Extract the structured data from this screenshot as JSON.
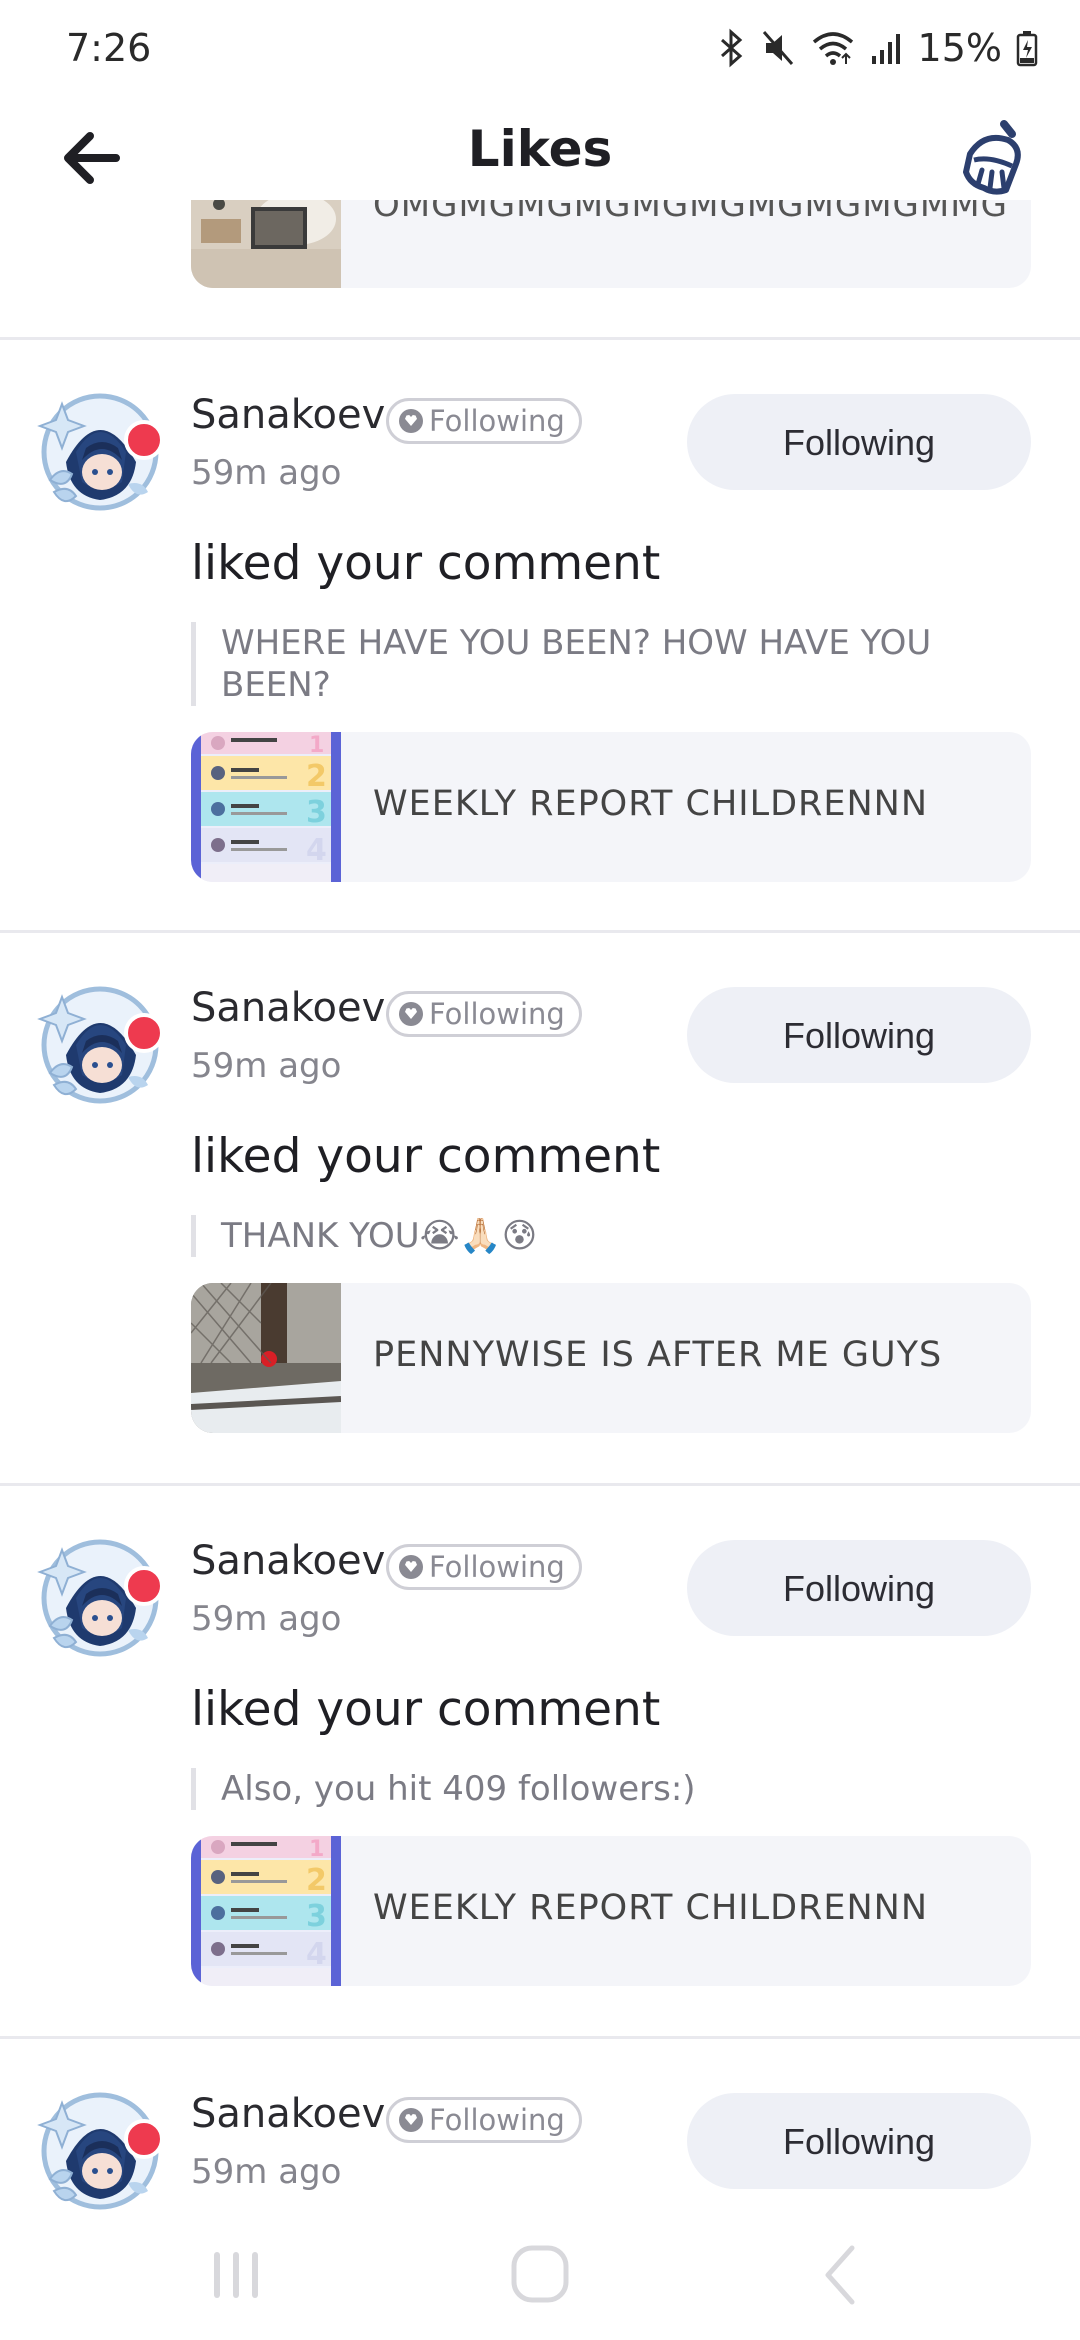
{
  "status_bar": {
    "time": "7:26",
    "battery": "15%"
  },
  "header": {
    "title": "Likes"
  },
  "top_post": {
    "title": "OMGMGMGMGMGMGMGMGMGMMG"
  },
  "items": [
    {
      "user": "Sanakoev",
      "badge": "Following",
      "time": "59m ago",
      "button": "Following",
      "action": "liked your comment",
      "quote": "WHERE HAVE YOU BEEN? HOW HAVE YOU BEEN?",
      "post_title": "WEEKLY REPORT CHILDRENNN"
    },
    {
      "user": "Sanakoev",
      "badge": "Following",
      "time": "59m ago",
      "button": "Following",
      "action": "liked your comment",
      "quote": "THANK YOU😭🙏🏻😰",
      "post_title": "PENNYWISE IS AFTER ME GUYS"
    },
    {
      "user": "Sanakoev",
      "badge": "Following",
      "time": "59m ago",
      "button": "Following",
      "action": "liked your comment",
      "quote": "Also, you hit 409 followers:)",
      "post_title": "WEEKLY REPORT CHILDRENNN"
    },
    {
      "user": "Sanakoev",
      "badge": "Following",
      "time": "59m ago",
      "button": "Following"
    }
  ]
}
